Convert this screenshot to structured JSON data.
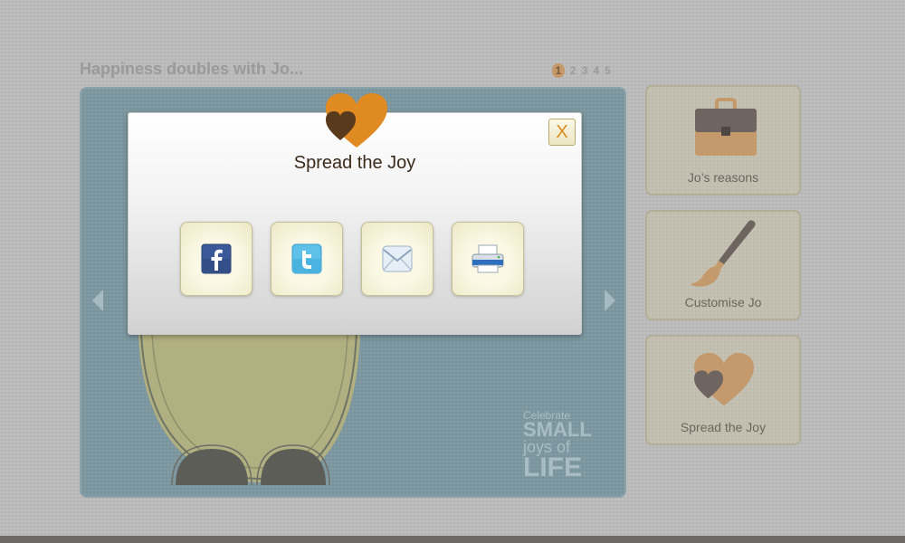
{
  "header": {
    "title": "Happiness doubles with Jo..."
  },
  "pager": {
    "pages": [
      "1",
      "2",
      "3",
      "4",
      "5"
    ],
    "active_index": 0
  },
  "stage": {
    "watermark": {
      "line1": "Celebrate",
      "line2": "SMALL",
      "line3": "joys of",
      "line4": "LIFE"
    }
  },
  "modal": {
    "title": "Spread the Joy",
    "close_label": "X",
    "share_buttons": [
      {
        "name": "facebook",
        "icon": "facebook-icon"
      },
      {
        "name": "twitter",
        "icon": "twitter-icon"
      },
      {
        "name": "email",
        "icon": "email-icon"
      },
      {
        "name": "print",
        "icon": "printer-icon"
      }
    ]
  },
  "sidebar": {
    "cards": [
      {
        "label": "Jo’s reasons",
        "icon": "briefcase-icon"
      },
      {
        "label": "Customise Jo",
        "icon": "paintbrush-icon"
      },
      {
        "label": "Spread the Joy",
        "icon": "hearts-icon"
      }
    ]
  },
  "colors": {
    "accent_orange": "#e08a22",
    "dark_brown": "#5a3a1c",
    "stage_blue": "#7f9aa2",
    "card_beige": "#c5c1b2"
  }
}
